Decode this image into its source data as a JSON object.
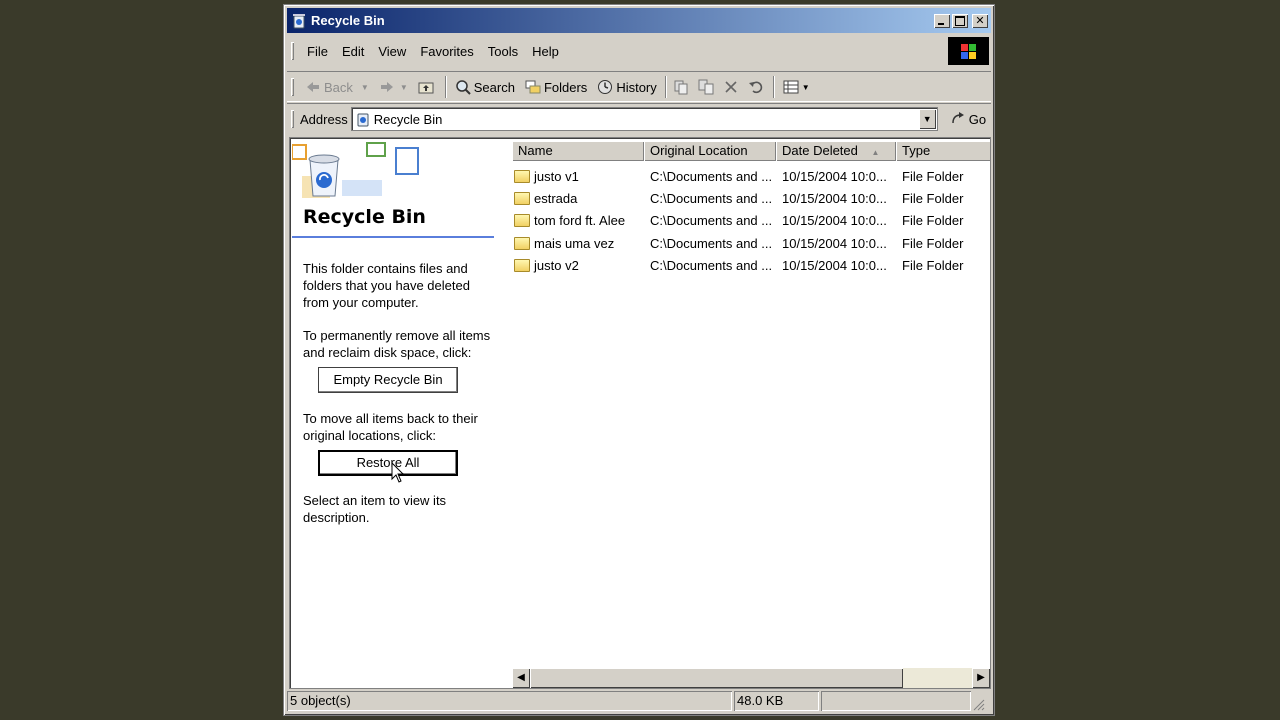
{
  "window": {
    "title": "Recycle Bin"
  },
  "menu": [
    "File",
    "Edit",
    "View",
    "Favorites",
    "Tools",
    "Help"
  ],
  "toolbar": {
    "back": "Back",
    "search": "Search",
    "folders": "Folders",
    "history": "History"
  },
  "address": {
    "label": "Address",
    "value": "Recycle Bin",
    "go": "Go"
  },
  "left_pane": {
    "title": "Recycle Bin",
    "description": "This folder contains files and folders that you have deleted from your computer.",
    "empty_text": "To permanently remove all items and reclaim disk space, click:",
    "empty_button": "Empty Recycle Bin",
    "restore_text": "To move all items back to their original locations, click:",
    "restore_button": "Restore All",
    "select_text": "Select an item to view its description."
  },
  "columns": [
    "Name",
    "Original Location",
    "Date Deleted",
    "Type"
  ],
  "sort_indicator": "▲",
  "files": [
    {
      "name": "justo v1",
      "location": "C:\\Documents and ...",
      "date": "10/15/2004 10:0...",
      "type": "File Folder"
    },
    {
      "name": "estrada",
      "location": "C:\\Documents and ...",
      "date": "10/15/2004 10:0...",
      "type": "File Folder"
    },
    {
      "name": "tom ford ft. Alee",
      "location": "C:\\Documents and ...",
      "date": "10/15/2004 10:0...",
      "type": "File Folder"
    },
    {
      "name": "mais uma vez",
      "location": "C:\\Documents and ...",
      "date": "10/15/2004 10:0...",
      "type": "File Folder"
    },
    {
      "name": "justo v2",
      "location": "C:\\Documents and ...",
      "date": "10/15/2004 10:0...",
      "type": "File Folder"
    }
  ],
  "status": {
    "objects": "5 object(s)",
    "size": "48.0 KB"
  }
}
